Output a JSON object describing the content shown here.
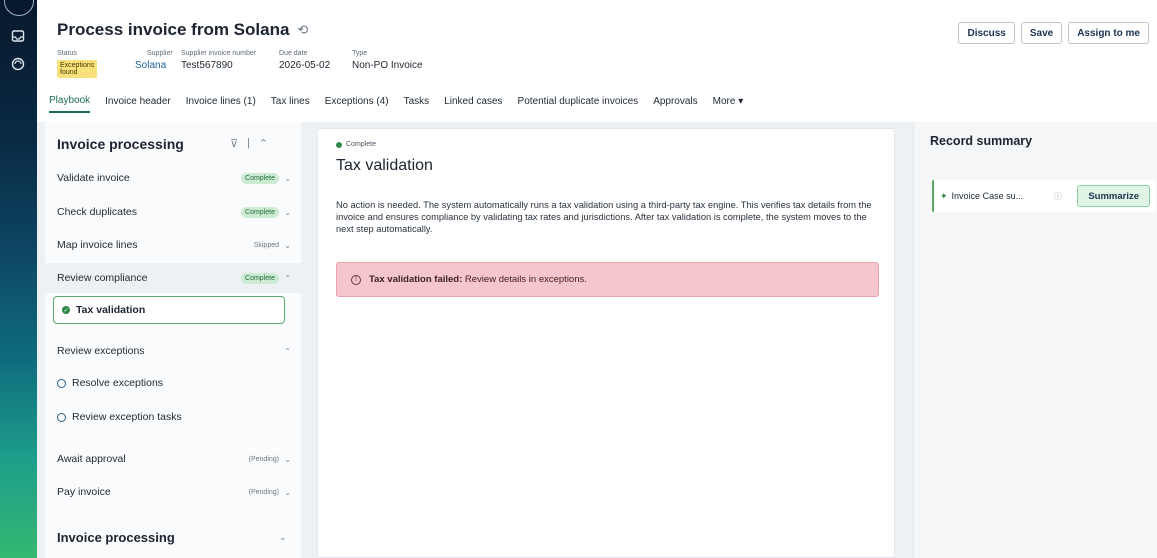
{
  "header": {
    "title": "Process invoice from Solana",
    "fields": [
      {
        "label": "Status",
        "value": "Exceptions found"
      },
      {
        "label": "Supplier",
        "value": "Solana"
      },
      {
        "label": "Supplier invoice number",
        "value": "Test567890"
      },
      {
        "label": "Due date",
        "value": "2026-05-02"
      },
      {
        "label": "Type",
        "value": "Non-PO Invoice"
      }
    ],
    "actions": {
      "discuss": "Discuss",
      "save": "Save",
      "assign": "Assign to me"
    }
  },
  "tabs": [
    "Playbook",
    "Invoice header",
    "Invoice lines (1)",
    "Tax lines",
    "Exceptions (4)",
    "Tasks",
    "Linked cases",
    "Potential duplicate invoices",
    "Approvals",
    "More ▾"
  ],
  "playbook": {
    "heading": "Invoice processing",
    "steps": [
      {
        "name": "Validate invoice",
        "status": "Complete"
      },
      {
        "name": "Check duplicates",
        "status": "Complete"
      },
      {
        "name": "Map invoice lines",
        "status": "Skipped"
      },
      {
        "name": "Review compliance",
        "status": "Complete"
      }
    ],
    "active_substep": "Tax validation",
    "exceptions_group": "Review exceptions",
    "exception_substeps": [
      "Resolve exceptions",
      "Review exception tasks"
    ],
    "later_steps": [
      {
        "name": "Await approval",
        "status": "(Pending)"
      },
      {
        "name": "Pay invoice",
        "status": "(Pending)"
      }
    ],
    "footer_heading": "Invoice processing"
  },
  "detail": {
    "status": "Complete",
    "title": "Tax validation",
    "body": "No action is needed. The system automatically runs a tax validation using a third-party tax engine. This verifies tax details from the invoice and ensures compliance by validating tax rates and jurisdictions. After tax validation is complete, the system moves to the next step automatically.",
    "alert_bold": "Tax validation failed:",
    "alert_text": " Review details in exceptions."
  },
  "record_summary": {
    "title": "Record summary",
    "card_text": "Invoice Case su...",
    "button": "Summarize"
  },
  "colors": {
    "accent_green": "#1b6e52",
    "alert_bg": "#f5c6cc",
    "complete_pill": "#cdebd3"
  }
}
